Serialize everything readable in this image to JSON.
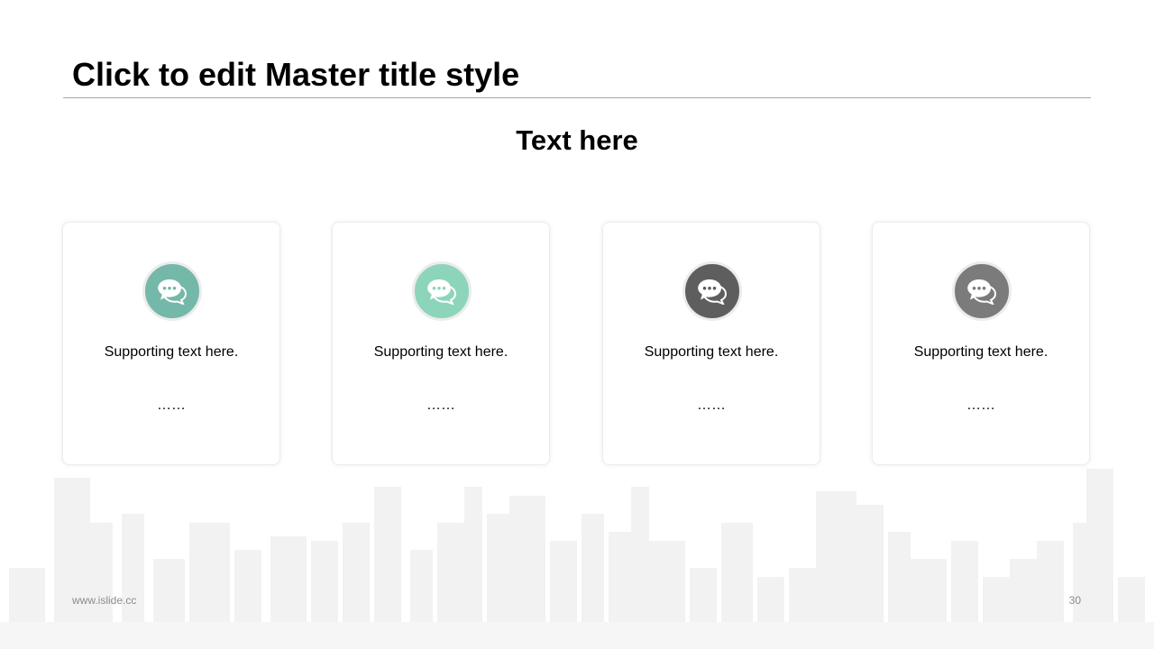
{
  "slide": {
    "title": "Click to edit Master title style",
    "subtitle": "Text here"
  },
  "cards": [
    {
      "text": "Supporting text here.",
      "dots": "……",
      "icon": "chat-bubbles-icon",
      "color": "#74b8a9"
    },
    {
      "text": "Supporting text here.",
      "dots": "……",
      "icon": "chat-bubbles-icon",
      "color": "#8dd5ba"
    },
    {
      "text": "Supporting text here.",
      "dots": "……",
      "icon": "chat-bubbles-icon",
      "color": "#5e5e5e"
    },
    {
      "text": "Supporting text here.",
      "dots": "……",
      "icon": "chat-bubbles-icon",
      "color": "#7b7b7b"
    }
  ],
  "footer": {
    "url": "www.islide.cc",
    "page_number": "30"
  }
}
